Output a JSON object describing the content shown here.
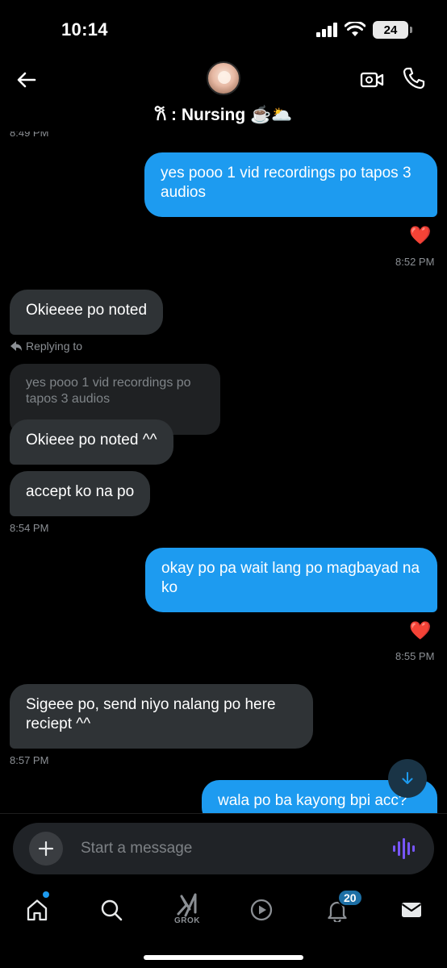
{
  "status_bar": {
    "time": "10:14",
    "battery": "24"
  },
  "header": {
    "contact_name": "𐙚 : Nursing ☕️🌥️"
  },
  "messages": {
    "top_timestamp": "8:49 PM",
    "m1": {
      "text": "yes pooo 1 vid recordings po tapos 3 audios",
      "reaction": "❤️",
      "time": "8:52 PM"
    },
    "m2": {
      "text": "Okieeee po noted"
    },
    "reply_label": "Replying to",
    "quoted_text": "yes pooo 1 vid recordings po tapos 3 audios",
    "m3": {
      "text": "Okieee po noted ^^"
    },
    "m4": {
      "text": "accept ko na po",
      "time": "8:54 PM"
    },
    "m5": {
      "text": "okay po pa wait lang po magbayad na ko",
      "reaction": "❤️",
      "time": "8:55 PM"
    },
    "m6": {
      "text": "Sigeee po, send niyo nalang po here reciept ^^",
      "time": "8:57 PM"
    },
    "m7": {
      "text": "wala po ba kayong bpi acc?"
    }
  },
  "composer": {
    "placeholder": "Start a message"
  },
  "tabbar": {
    "grok_label": "GROK",
    "notifications_count": "20"
  },
  "colors": {
    "outgoing": "#1d9bf0",
    "incoming": "#2f3336",
    "accent": "#1d9bf0",
    "voice": "#7856ff"
  }
}
